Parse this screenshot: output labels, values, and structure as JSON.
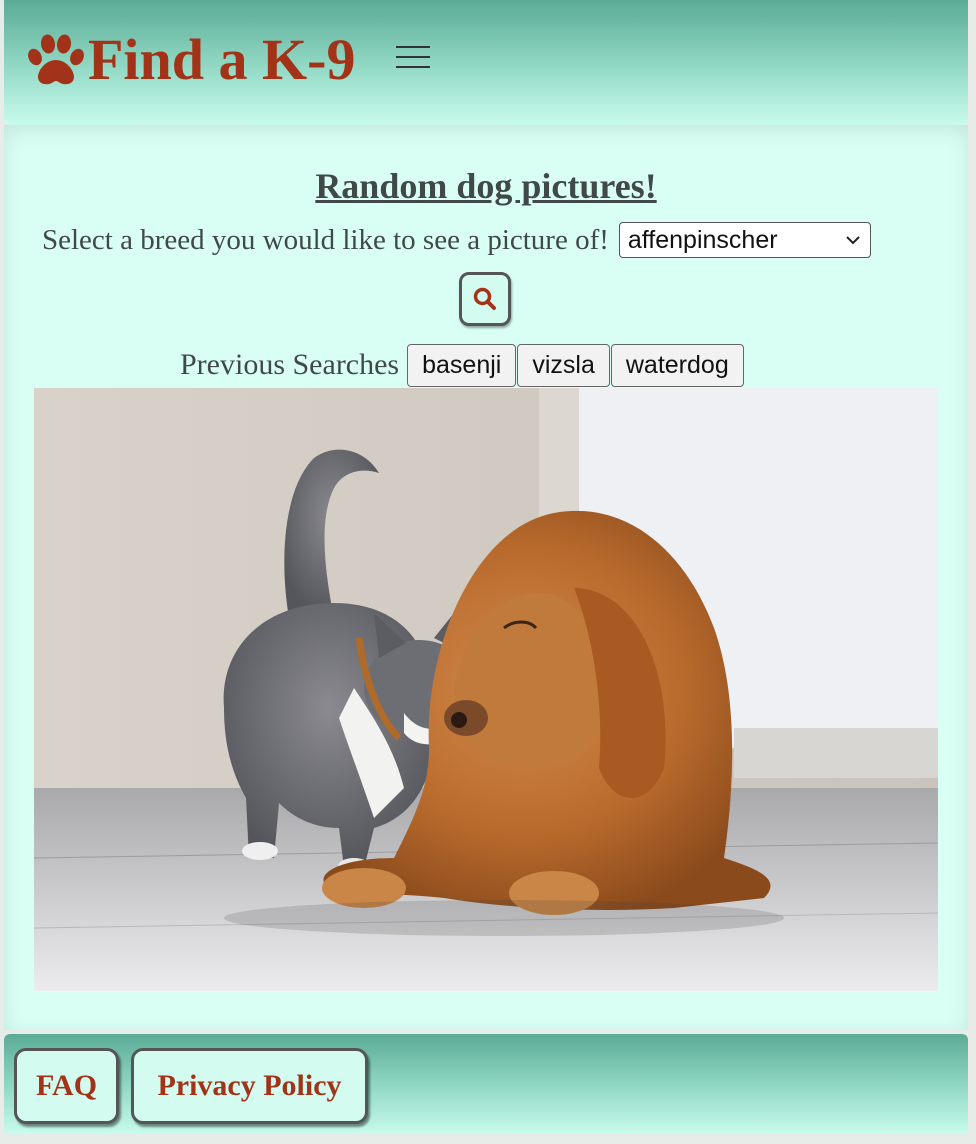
{
  "header": {
    "logo_icon": "paw-icon",
    "logo_text": "Find a K-9",
    "menu_icon": "hamburger-menu-icon"
  },
  "main": {
    "title": "Random dog pictures!",
    "breed_prompt": "Select a breed you would like to see a picture of!",
    "breed_select": {
      "selected": "affenpinscher"
    },
    "search_icon": "search-icon",
    "previous_searches_label": "Previous Searches",
    "previous_searches": [
      "basenji",
      "vizsla",
      "waterdog"
    ],
    "photo": "cat-and-golden-retriever-photo"
  },
  "footer": {
    "links": [
      "FAQ",
      "Privacy Policy"
    ]
  },
  "colors": {
    "brand_red": "#a23318",
    "header_gradient_top": "#5aab96",
    "header_gradient_bottom": "#c8fbec",
    "main_background": "#d9fff4",
    "text_gray": "#414848"
  }
}
